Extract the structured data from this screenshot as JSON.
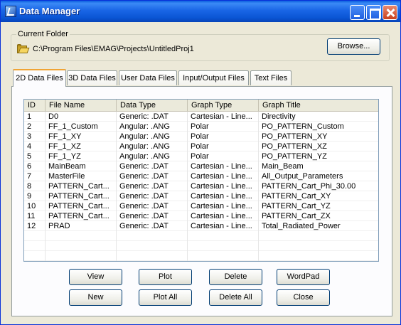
{
  "window": {
    "title": "Data Manager"
  },
  "current_folder": {
    "label": "Current Folder",
    "path": "C:\\Program Files\\EMAG\\Projects\\UntitledProj1",
    "browse_label": "Browse..."
  },
  "tabs": [
    {
      "label": "2D Data Files",
      "active": true
    },
    {
      "label": "3D Data Files",
      "active": false
    },
    {
      "label": "User Data Files",
      "active": false
    },
    {
      "label": "Input/Output Files",
      "active": false
    },
    {
      "label": "Text Files",
      "active": false
    }
  ],
  "table": {
    "columns": [
      "ID",
      "File Name",
      "Data Type",
      "Graph Type",
      "Graph Title"
    ],
    "rows": [
      [
        "1",
        "D0",
        "Generic: .DAT",
        "Cartesian - Line...",
        "Directivity"
      ],
      [
        "2",
        "FF_1_Custom",
        "Angular: .ANG",
        "Polar",
        "PO_PATTERN_Custom"
      ],
      [
        "3",
        "FF_1_XY",
        "Angular: .ANG",
        "Polar",
        "PO_PATTERN_XY"
      ],
      [
        "4",
        "FF_1_XZ",
        "Angular: .ANG",
        "Polar",
        "PO_PATTERN_XZ"
      ],
      [
        "5",
        "FF_1_YZ",
        "Angular: .ANG",
        "Polar",
        "PO_PATTERN_YZ"
      ],
      [
        "6",
        "MainBeam",
        "Generic: .DAT",
        "Cartesian - Line...",
        "Main_Beam"
      ],
      [
        "7",
        "MasterFile",
        "Generic: .DAT",
        "Cartesian - Line...",
        "All_Output_Parameters"
      ],
      [
        "8",
        "PATTERN_Cart...",
        "Generic: .DAT",
        "Cartesian - Line...",
        "PATTERN_Cart_Phi_30.00"
      ],
      [
        "9",
        "PATTERN_Cart...",
        "Generic: .DAT",
        "Cartesian - Line...",
        "PATTERN_Cart_XY"
      ],
      [
        "10",
        "PATTERN_Cart...",
        "Generic: .DAT",
        "Cartesian - Line...",
        "PATTERN_Cart_YZ"
      ],
      [
        "11",
        "PATTERN_Cart...",
        "Generic: .DAT",
        "Cartesian - Line...",
        "PATTERN_Cart_ZX"
      ],
      [
        "12",
        "PRAD",
        "Generic: .DAT",
        "Cartesian - Line...",
        "Total_Radiated_Power"
      ]
    ]
  },
  "buttons": {
    "view": "View",
    "plot": "Plot",
    "delete": "Delete",
    "wordpad": "WordPad",
    "new": "New",
    "plot_all": "Plot All",
    "delete_all": "Delete All",
    "close": "Close"
  },
  "colors": {
    "titlebar": "#0a55d4",
    "window_bg": "#ece9d8",
    "active_tab_accent": "#f0a435"
  }
}
